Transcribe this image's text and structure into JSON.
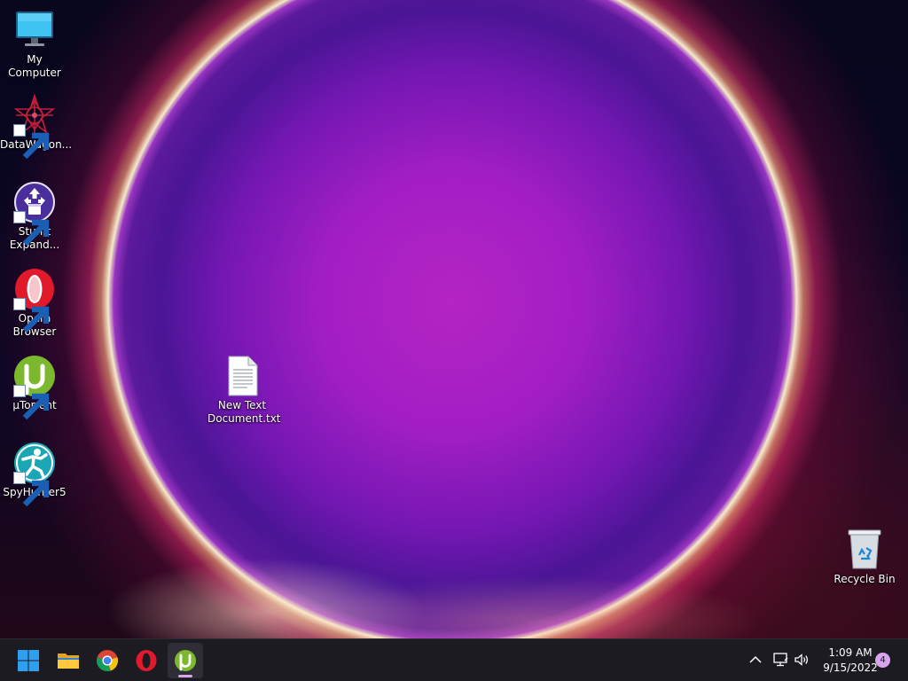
{
  "desktop": {
    "icons": [
      {
        "label_line1": "My Computer",
        "label_line2": "",
        "icon": "monitor-icon",
        "shortcut": false
      },
      {
        "label_line1": "DataWagon...",
        "label_line2": "",
        "icon": "datawagon-icon",
        "shortcut": true
      },
      {
        "label_line1": "StuffIt",
        "label_line2": "Expand...",
        "icon": "stuffit-icon",
        "shortcut": true
      },
      {
        "label_line1": "Opera",
        "label_line2": "Browser",
        "icon": "opera-icon",
        "shortcut": true
      },
      {
        "label_line1": "µTorrent",
        "label_line2": "",
        "icon": "utorrent-icon",
        "shortcut": true
      },
      {
        "label_line1": "SpyHunter5",
        "label_line2": "",
        "icon": "spyhunter-icon",
        "shortcut": true
      },
      {
        "label_line1": "New Text",
        "label_line2": "Document.txt",
        "icon": "text-file-icon",
        "shortcut": false
      },
      {
        "label_line1": "Recycle Bin",
        "label_line2": "",
        "icon": "recycle-bin-icon",
        "shortcut": false
      }
    ]
  },
  "taskbar": {
    "apps": [
      {
        "name": "Start",
        "icon": "windows-start-icon",
        "active": false
      },
      {
        "name": "File Explorer",
        "icon": "folder-icon",
        "active": false
      },
      {
        "name": "Google Chrome",
        "icon": "chrome-icon",
        "active": false
      },
      {
        "name": "Opera",
        "icon": "opera-icon",
        "active": false
      },
      {
        "name": "µTorrent",
        "icon": "utorrent-icon",
        "active": true
      }
    ],
    "tray": {
      "icons": [
        "chevron-up-icon",
        "network-icon",
        "volume-icon"
      ],
      "time": "1:09 AM",
      "date": "9/15/2022",
      "notification_count": "4"
    }
  },
  "colors": {
    "taskbar_bg": "#1c1b22",
    "active_indicator": "#d7a8e8",
    "notification_badge": "#d9a4ee",
    "start_blue": "#2fa0f0",
    "utorrent_green": "#7cb82e",
    "opera_red": "#e0192b"
  }
}
